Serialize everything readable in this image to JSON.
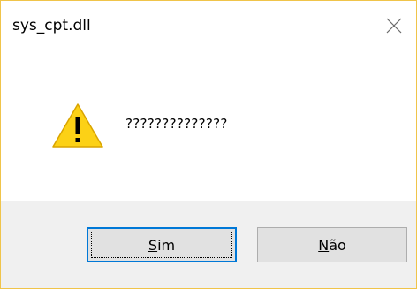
{
  "dialog": {
    "title": "sys_cpt.dll",
    "message": "??????????????",
    "icon": "warning-icon",
    "buttons": {
      "yes": {
        "mnemonic": "S",
        "rest": "im"
      },
      "no": {
        "mnemonic": "N",
        "rest": "ão"
      }
    }
  },
  "colors": {
    "border": "#f0c44a",
    "footer_bg": "#f0f0f0",
    "button_bg": "#e1e1e1",
    "default_button_border": "#0078d7",
    "warning_fill": "#fcd116"
  }
}
